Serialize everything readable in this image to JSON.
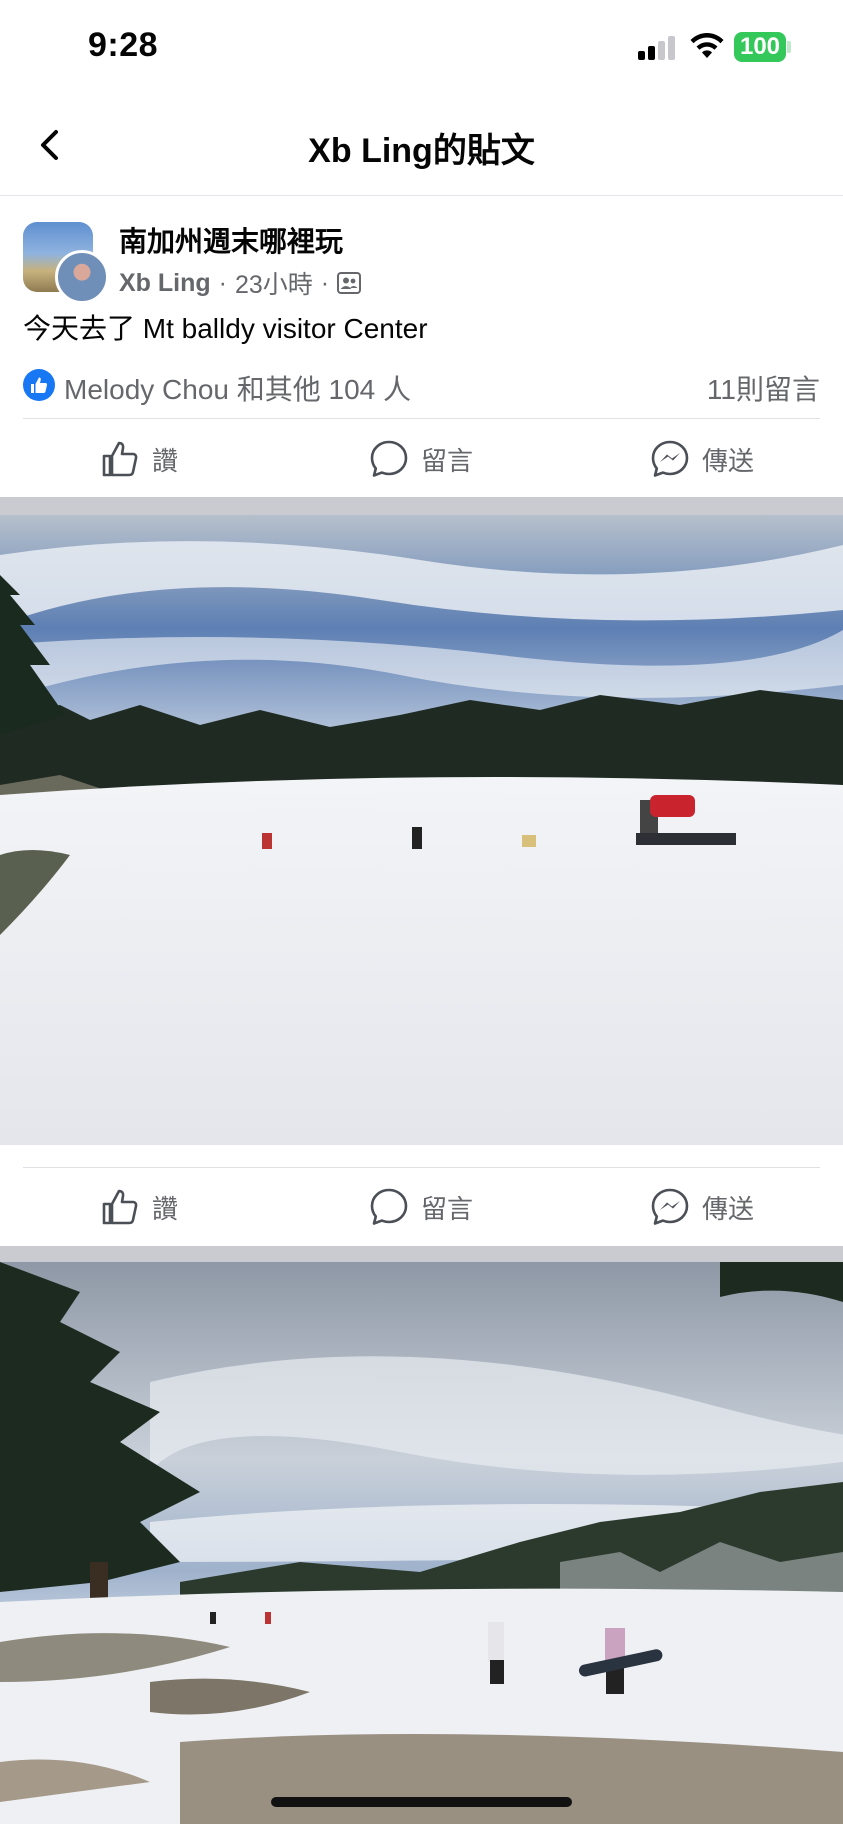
{
  "status_bar": {
    "time": "9:28",
    "battery": "100",
    "signal_bars_active": 2,
    "signal_bars_total": 4
  },
  "header": {
    "title": "Xb Ling的貼文"
  },
  "post": {
    "group_name": "南加州週末哪裡玩",
    "author": "Xb Ling",
    "separator": "·",
    "time_ago": "23小時",
    "text": "今天去了 Mt balldy visitor Center",
    "reactions_summary": "Melody Chou 和其他 104 人",
    "comments_count": "11則留言"
  },
  "actions": {
    "like": "讚",
    "comment": "留言",
    "share": "傳送"
  },
  "icons": {
    "back": "chevron-left-icon",
    "like": "thumbs-up-icon",
    "comment": "speech-bubble-icon",
    "share": "messenger-icon",
    "privacy": "group-audience-icon"
  },
  "colors": {
    "accent": "#1877f2",
    "battery": "#34c759",
    "secondary_text": "#65676b",
    "band": "#c9cbd0"
  }
}
